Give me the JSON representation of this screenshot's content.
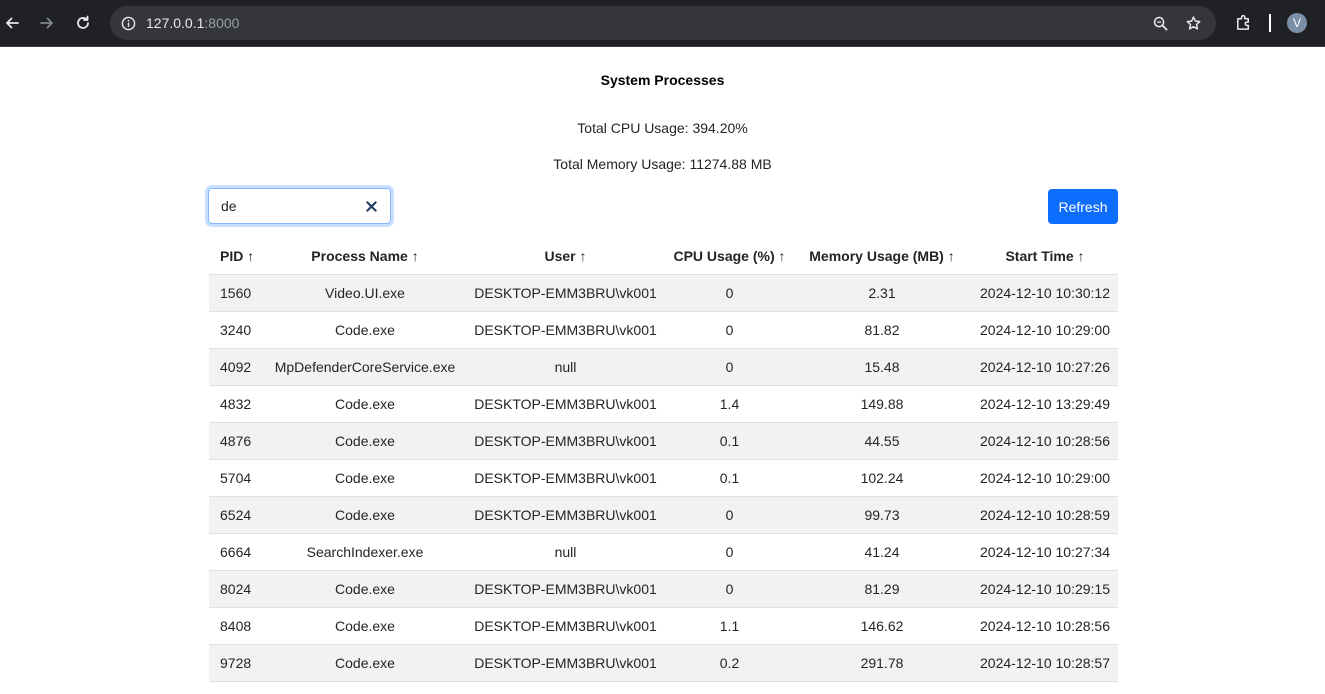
{
  "browser": {
    "url_host": "127.0.0.1",
    "url_port": ":8000",
    "avatar_letter": "V"
  },
  "page": {
    "title": "System Processes",
    "total_cpu": "Total CPU Usage: 394.20%",
    "total_memory": "Total Memory Usage: 11274.88 MB"
  },
  "search": {
    "value": "de"
  },
  "refresh_label": "Refresh",
  "table": {
    "headers": {
      "pid": "PID ↑",
      "name": "Process Name ↑",
      "user": "User ↑",
      "cpu": "CPU Usage (%) ↑",
      "memory": "Memory Usage (MB) ↑",
      "start": "Start Time ↑"
    },
    "rows": [
      {
        "pid": "1560",
        "name": "Video.UI.exe",
        "user": "DESKTOP-EMM3BRU\\vk001",
        "cpu": "0",
        "memory": "2.31",
        "start": "2024-12-10 10:30:12"
      },
      {
        "pid": "3240",
        "name": "Code.exe",
        "user": "DESKTOP-EMM3BRU\\vk001",
        "cpu": "0",
        "memory": "81.82",
        "start": "2024-12-10 10:29:00"
      },
      {
        "pid": "4092",
        "name": "MpDefenderCoreService.exe",
        "user": "null",
        "cpu": "0",
        "memory": "15.48",
        "start": "2024-12-10 10:27:26"
      },
      {
        "pid": "4832",
        "name": "Code.exe",
        "user": "DESKTOP-EMM3BRU\\vk001",
        "cpu": "1.4",
        "memory": "149.88",
        "start": "2024-12-10 13:29:49"
      },
      {
        "pid": "4876",
        "name": "Code.exe",
        "user": "DESKTOP-EMM3BRU\\vk001",
        "cpu": "0.1",
        "memory": "44.55",
        "start": "2024-12-10 10:28:56"
      },
      {
        "pid": "5704",
        "name": "Code.exe",
        "user": "DESKTOP-EMM3BRU\\vk001",
        "cpu": "0.1",
        "memory": "102.24",
        "start": "2024-12-10 10:29:00"
      },
      {
        "pid": "6524",
        "name": "Code.exe",
        "user": "DESKTOP-EMM3BRU\\vk001",
        "cpu": "0",
        "memory": "99.73",
        "start": "2024-12-10 10:28:59"
      },
      {
        "pid": "6664",
        "name": "SearchIndexer.exe",
        "user": "null",
        "cpu": "0",
        "memory": "41.24",
        "start": "2024-12-10 10:27:34"
      },
      {
        "pid": "8024",
        "name": "Code.exe",
        "user": "DESKTOP-EMM3BRU\\vk001",
        "cpu": "0",
        "memory": "81.29",
        "start": "2024-12-10 10:29:15"
      },
      {
        "pid": "8408",
        "name": "Code.exe",
        "user": "DESKTOP-EMM3BRU\\vk001",
        "cpu": "1.1",
        "memory": "146.62",
        "start": "2024-12-10 10:28:56"
      },
      {
        "pid": "9728",
        "name": "Code.exe",
        "user": "DESKTOP-EMM3BRU\\vk001",
        "cpu": "0.2",
        "memory": "291.78",
        "start": "2024-12-10 10:28:57"
      }
    ]
  }
}
